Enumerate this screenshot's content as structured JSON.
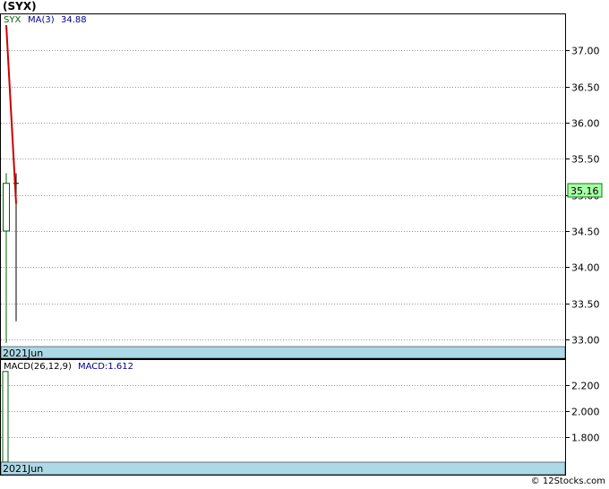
{
  "title": "(SYX)",
  "watermark": "© 12Stocks.com",
  "chart_data": [
    {
      "type": "candlestick",
      "symbol": "SYX",
      "ma_label": "MA(3)",
      "ma_value": "34.88",
      "last_price": "35.16",
      "date_label": "2021Jun",
      "ylim": [
        32.9,
        37.5
      ],
      "y_ticks": [
        "37.00",
        "36.50",
        "36.00",
        "35.50",
        "35.00",
        "34.50",
        "34.00",
        "33.50",
        "33.00"
      ],
      "candles": [
        {
          "open": 34.5,
          "high": 35.3,
          "low": 32.95,
          "close": 35.16,
          "color": "#006400"
        },
        {
          "open": 35.16,
          "high": 35.3,
          "low": 33.25,
          "close": 35.16,
          "color": "#000000"
        }
      ],
      "ma_line": [
        37.35,
        34.88
      ],
      "colors": {
        "up": "#006400",
        "ma": "#cc0000",
        "price_box": "#aaffaa",
        "date_bar": "#add8e6",
        "legend_ma": "#00008b"
      }
    },
    {
      "type": "bar",
      "indicator": "MACD(26,12,9)",
      "macd_label": "MACD:1.612",
      "date_label": "2021Jun",
      "ylim": [
        1.6,
        2.4
      ],
      "y_ticks": [
        "2.200",
        "2.000",
        "1.800"
      ],
      "bars": [
        2.31
      ]
    }
  ]
}
